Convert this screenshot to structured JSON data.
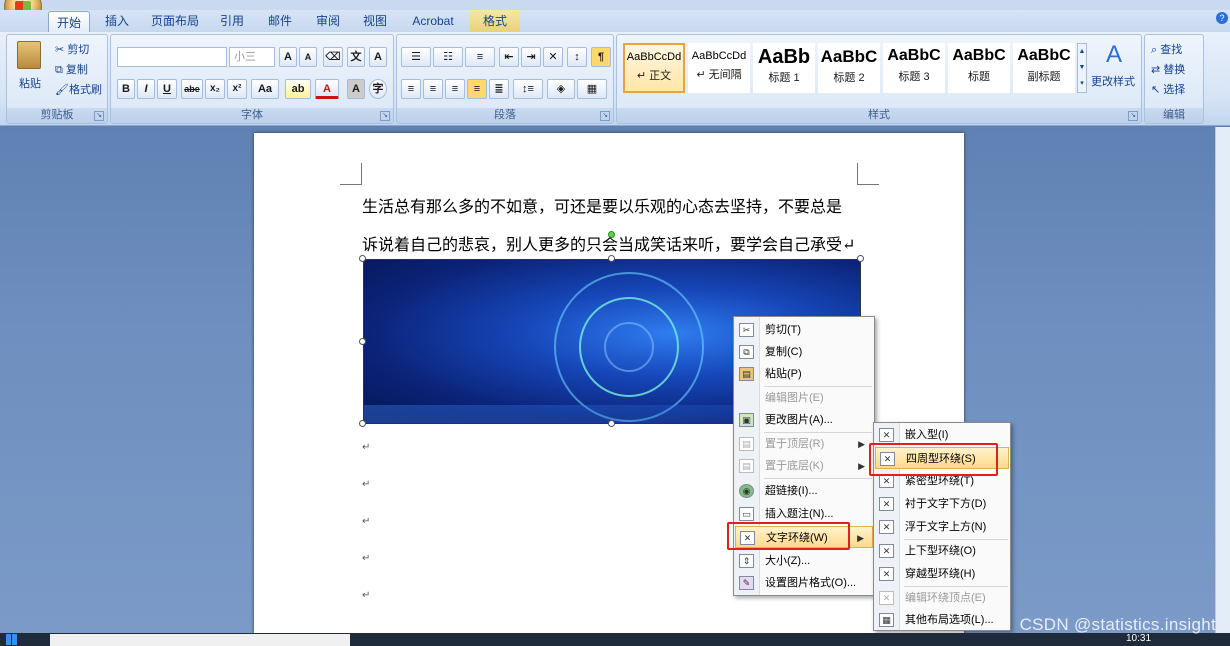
{
  "ribbon_tabs": [
    {
      "label": "开始",
      "active": true
    },
    {
      "label": "插入"
    },
    {
      "label": "页面布局"
    },
    {
      "label": "引用"
    },
    {
      "label": "邮件"
    },
    {
      "label": "审阅"
    },
    {
      "label": "视图"
    },
    {
      "label": "Acrobat"
    },
    {
      "label": "格式"
    }
  ],
  "clipboard": {
    "paste": "粘贴",
    "cut": "剪切",
    "copy": "复制",
    "format_painter": "格式刷",
    "group": "剪贴板"
  },
  "font": {
    "font_name": "",
    "font_size": "小三",
    "group": "字体",
    "btn_bold": "B",
    "btn_italic": "I",
    "btn_underline": "U",
    "btn_strike": "abe",
    "btn_sub": "x₂",
    "btn_sup": "x²",
    "btn_case": "Aa",
    "btn_color": "A",
    "btn_grow": "A",
    "btn_shrink": "A"
  },
  "paragraph": {
    "group": "段落"
  },
  "styles": {
    "group": "样式",
    "change_styles": "更改样式",
    "tiles": [
      {
        "sample": "AaBbCcDd",
        "name": "↵ 正文",
        "selected": true
      },
      {
        "sample": "AaBbCcDd",
        "name": "↵ 无间隔"
      },
      {
        "sample": "AaBb",
        "name": "标题 1"
      },
      {
        "sample": "AaBbC",
        "name": "标题 2"
      },
      {
        "sample": "AaBbC",
        "name": "标题 3"
      },
      {
        "sample": "AaBbC",
        "name": "标题"
      },
      {
        "sample": "AaBbC",
        "name": "副标题"
      }
    ]
  },
  "editing": {
    "group": "编辑",
    "find": "查找",
    "replace": "替换",
    "select": "选择"
  },
  "document": {
    "line1": "生活总有那么多的不如意，可还是要以乐观的心态去坚持，不要总是",
    "line2": "诉说着自己的悲哀，别人更多的只会当成笑话来听，要学会自己承受↵",
    "para_mark": "↵"
  },
  "context_menu": {
    "items": [
      {
        "label": "剪切(T)",
        "icon": "scissors-icon",
        "enabled": true
      },
      {
        "label": "复制(C)",
        "icon": "copy-icon",
        "enabled": true
      },
      {
        "label": "粘贴(P)",
        "icon": "paste-icon",
        "enabled": true
      },
      {
        "label": "编辑图片(E)",
        "enabled": false,
        "sep_before": true
      },
      {
        "label": "更改图片(A)...",
        "icon": "change-picture-icon",
        "enabled": true
      },
      {
        "label": "置于顶层(R)",
        "icon": "bring-front-icon",
        "enabled": false,
        "submenu": true,
        "sep_before": true
      },
      {
        "label": "置于底层(K)",
        "icon": "send-back-icon",
        "enabled": false,
        "submenu": true
      },
      {
        "label": "超链接(I)...",
        "icon": "hyperlink-icon",
        "enabled": true,
        "sep_before": true
      },
      {
        "label": "插入题注(N)...",
        "icon": "caption-icon",
        "enabled": true
      },
      {
        "label": "文字环绕(W)",
        "icon": "wrap-text-icon",
        "enabled": true,
        "submenu": true,
        "highlighted": true
      },
      {
        "label": "大小(Z)...",
        "icon": "size-icon",
        "enabled": true
      },
      {
        "label": "设置图片格式(O)...",
        "icon": "format-picture-icon",
        "enabled": true
      }
    ]
  },
  "wrap_submenu": {
    "items": [
      {
        "label": "嵌入型(I)",
        "enabled": true
      },
      {
        "label": "四周型环绕(S)",
        "enabled": true,
        "highlighted": true
      },
      {
        "label": "紧密型环绕(T)",
        "enabled": true
      },
      {
        "label": "衬于文字下方(D)",
        "enabled": true
      },
      {
        "label": "浮于文字上方(N)",
        "enabled": true
      },
      {
        "label": "上下型环绕(O)",
        "enabled": true,
        "sep_before": true
      },
      {
        "label": "穿越型环绕(H)",
        "enabled": true
      },
      {
        "label": "编辑环绕顶点(E)",
        "enabled": false,
        "sep_before": true
      },
      {
        "label": "其他布局选项(L)...",
        "enabled": true
      }
    ]
  },
  "watermark": "CSDN @statistics.insight",
  "taskbar": {
    "time": "10:31"
  },
  "colors": {
    "highlight_box": "#e02020",
    "ribbon_bg": "#dae7f7"
  }
}
